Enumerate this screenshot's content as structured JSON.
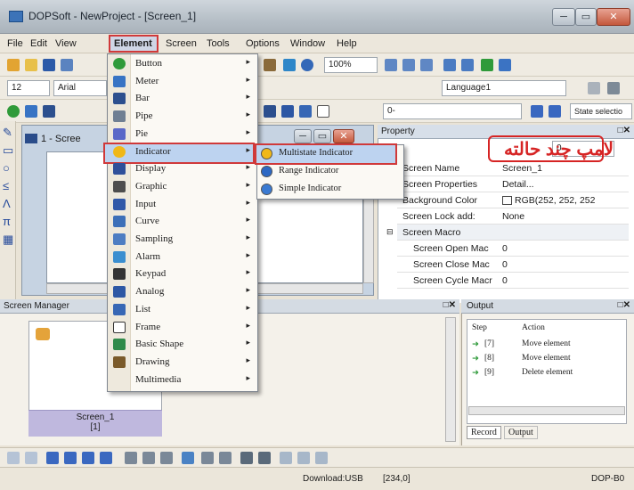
{
  "window": {
    "title": "DOPSoft - NewProject - [Screen_1]",
    "buttons": [
      "─",
      "▭",
      "✕"
    ]
  },
  "menubar": {
    "items": [
      "File",
      "Edit",
      "View",
      "Element",
      "Screen",
      "Tools",
      "Options",
      "Window",
      "Help"
    ]
  },
  "toolbar": {
    "zoom": "100%",
    "font_size": "12",
    "font_name": "Arial",
    "language": "Language1",
    "state_field": "0-",
    "state_selector": "State selectio"
  },
  "screen_window": {
    "title": "1 - Scree"
  },
  "element_menu": {
    "items": [
      {
        "label": "Button",
        "icon": "button-icon",
        "color": "#2f9a3a",
        "arrow": "▸"
      },
      {
        "label": "Meter",
        "icon": "meter-icon",
        "color": "#3773c4",
        "arrow": "▸"
      },
      {
        "label": "Bar",
        "icon": "bar-icon",
        "color": "#2c4f8e",
        "arrow": "▸"
      },
      {
        "label": "Pipe",
        "icon": "pipe-icon",
        "color": "#6f7f93",
        "arrow": "▸"
      },
      {
        "label": "Pie",
        "icon": "pie-icon",
        "color": "#5a68c8",
        "arrow": "▸"
      },
      {
        "label": "Indicator",
        "icon": "indicator-icon",
        "color": "#f0b818",
        "arrow": "▸"
      },
      {
        "label": "Display",
        "icon": "display-icon",
        "color": "#2e4f9a",
        "arrow": "▸"
      },
      {
        "label": "Graphic",
        "icon": "graphic-icon",
        "color": "#4d4d4d",
        "arrow": "▸"
      },
      {
        "label": "Input",
        "icon": "input-icon",
        "color": "#3058a8",
        "arrow": "▸"
      },
      {
        "label": "Curve",
        "icon": "curve-icon",
        "color": "#3c6fb8",
        "arrow": "▸"
      },
      {
        "label": "Sampling",
        "icon": "sampling-icon",
        "color": "#4c7cc2",
        "arrow": "▸"
      },
      {
        "label": "Alarm",
        "icon": "alarm-icon",
        "color": "#3a8ed0",
        "arrow": "▸"
      },
      {
        "label": "Keypad",
        "icon": "keypad-icon",
        "color": "#333333",
        "arrow": "▸"
      },
      {
        "label": "Analog",
        "icon": "analog-icon",
        "color": "#2d57a4",
        "arrow": "▸"
      },
      {
        "label": "List",
        "icon": "list-icon",
        "color": "#3767b5",
        "arrow": "▸"
      },
      {
        "label": "Frame",
        "icon": "frame-icon",
        "color": "#ffffff",
        "arrow": "▸"
      },
      {
        "label": "Basic Shape",
        "icon": "basic-shape-icon",
        "color": "#2f8a4a",
        "arrow": "▸"
      },
      {
        "label": "Drawing",
        "icon": "drawing-icon",
        "color": "#7a5a2a",
        "arrow": "▸"
      },
      {
        "label": "Multimedia",
        "icon": "",
        "color": "",
        "arrow": "▸"
      }
    ]
  },
  "indicator_submenu": {
    "items": [
      {
        "label": "Multistate Indicator",
        "icon": "multistate-indicator-icon",
        "color": "#f0b818"
      },
      {
        "label": "Range Indicator",
        "icon": "range-indicator-icon",
        "color": "#2d68c4"
      },
      {
        "label": "Simple Indicator",
        "icon": "simple-indicator-icon",
        "color": "#3a7ad2"
      }
    ]
  },
  "property": {
    "title": "Property",
    "combo_value": "0",
    "rows": [
      {
        "key": "Screen Name",
        "value": "Screen_1"
      },
      {
        "key": "Screen Properties",
        "value": "Detail..."
      },
      {
        "key": "Background Color",
        "value": "RGB(252, 252, 252"
      },
      {
        "key": "Screen Lock add:",
        "value": "None"
      },
      {
        "key": "Screen Macro",
        "value": ""
      },
      {
        "key": "Screen Open Mac",
        "value": "0"
      },
      {
        "key": "Screen Close Mac",
        "value": "0"
      },
      {
        "key": "Screen Cycle Macr",
        "value": "0"
      }
    ]
  },
  "annotation": {
    "text": "لامپ چند حالته"
  },
  "screen_manager": {
    "title": "Screen Manager",
    "thumb_name": "Screen_1",
    "thumb_id": "[1]"
  },
  "output": {
    "title": "Output",
    "columns": [
      "Step",
      "Action"
    ],
    "rows": [
      {
        "step": "[7]",
        "action": "Move element"
      },
      {
        "step": "[8]",
        "action": "Move element"
      },
      {
        "step": "[9]",
        "action": "Delete element"
      }
    ],
    "tabs": [
      "Record",
      "Output"
    ]
  },
  "statusbar": {
    "download": "Download:USB",
    "coords": "[234,0]",
    "model": "DOP-B0"
  },
  "colors": {
    "highlight_border": "#d0393a",
    "annotation": "#d62424"
  }
}
